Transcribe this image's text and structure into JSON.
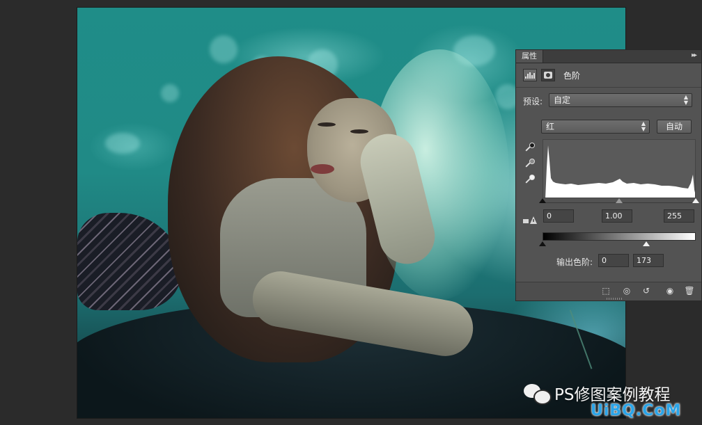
{
  "panel": {
    "tab_title": "属性",
    "menu_glyph": "▸▸",
    "header_label": "色阶",
    "preset_label": "预设:",
    "preset_value": "自定",
    "channel_value": "红",
    "auto_button": "自动",
    "input_levels": {
      "black": "0",
      "gamma": "1.00",
      "white": "255"
    },
    "output_label": "输出色阶:",
    "output_levels": {
      "black": "0",
      "white": "173"
    },
    "icons": {
      "levels": "levels-icon",
      "mask": "mask-icon",
      "eyedropper_black": "eyedropper-black-icon",
      "eyedropper_gray": "eyedropper-gray-icon",
      "eyedropper_white": "eyedropper-white-icon",
      "clip": "clip-to-layer-icon",
      "view_previous": "view-previous-icon",
      "reset": "reset-icon",
      "visibility": "eye-icon",
      "delete": "trash-icon"
    }
  },
  "watermark": {
    "text": "PS修图案例教程",
    "site": "UiBQ.CoM"
  },
  "colors": {
    "panel_bg": "#535353",
    "canvas_bg": "#2b2b2b",
    "photo_tone": "#1f8d88",
    "site_watermark": "#2aa4e8"
  }
}
